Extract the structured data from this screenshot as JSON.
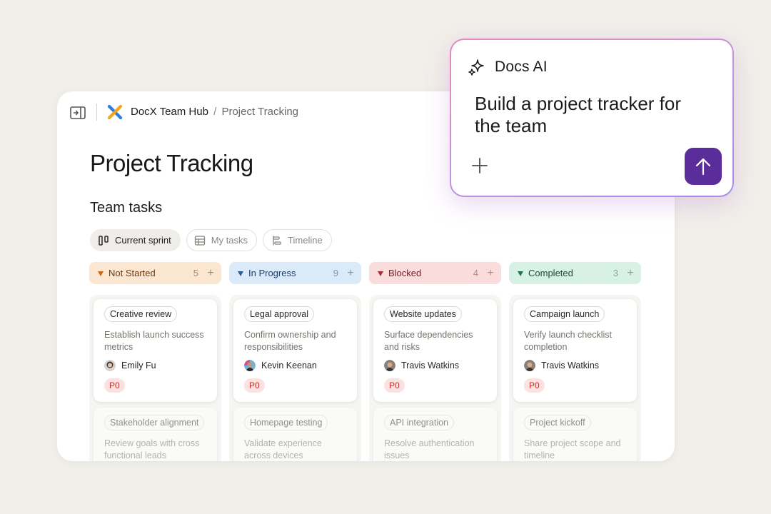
{
  "breadcrumb": {
    "workspace": "DocX Team Hub",
    "separator": "/",
    "page": "Project Tracking"
  },
  "page_title": "Project Tracking",
  "section_title": "Team tasks",
  "view_tabs": [
    {
      "label": "Current sprint",
      "icon": "board-icon",
      "active": true
    },
    {
      "label": "My tasks",
      "icon": "table-icon",
      "active": false
    },
    {
      "label": "Timeline",
      "icon": "timeline-icon",
      "active": false
    }
  ],
  "columns": [
    {
      "label": "Not Started",
      "count": "5",
      "add": "+",
      "bg": "#fbe6d2",
      "text": "#6b3a10",
      "accent": "#c76a1b",
      "cards": [
        {
          "tag": "Creative review",
          "desc": "Establish launch success metrics",
          "assignee": "Emily Fu",
          "priority": "P0"
        },
        {
          "tag": "Stakeholder alignment",
          "desc": "Review goals with cross functional leads"
        }
      ]
    },
    {
      "label": "In Progress",
      "count": "9",
      "add": "+",
      "bg": "#dbeaf8",
      "text": "#1c3f66",
      "accent": "#2a5d95",
      "cards": [
        {
          "tag": "Legal approval",
          "desc": "Confirm ownership and responsibilities",
          "assignee": "Kevin Keenan",
          "priority": "P0"
        },
        {
          "tag": "Homepage testing",
          "desc": "Validate experience across devices"
        }
      ]
    },
    {
      "label": "Blocked",
      "count": "4",
      "add": "+",
      "bg": "#fadcdc",
      "text": "#6a1f24",
      "accent": "#a8303a",
      "cards": [
        {
          "tag": "Website updates",
          "desc": "Surface dependencies and risks",
          "assignee": "Travis Watkins",
          "priority": "P0"
        },
        {
          "tag": "API integration",
          "desc": "Resolve authentication issues"
        }
      ]
    },
    {
      "label": "Completed",
      "count": "3",
      "add": "+",
      "bg": "#d8f1e6",
      "text": "#1d4a39",
      "accent": "#22725a",
      "cards": [
        {
          "tag": "Campaign launch",
          "desc": "Verify launch checklist completion",
          "assignee": "Travis Watkins",
          "priority": "P0"
        },
        {
          "tag": "Project kickoff",
          "desc": "Share project scope and timeline"
        }
      ]
    }
  ],
  "ai_panel": {
    "title": "Docs AI",
    "prompt": "Build a project tracker for the team",
    "plus_icon": "plus-icon",
    "send_icon": "arrow-up-icon",
    "send_color": "#5b2d9a"
  }
}
